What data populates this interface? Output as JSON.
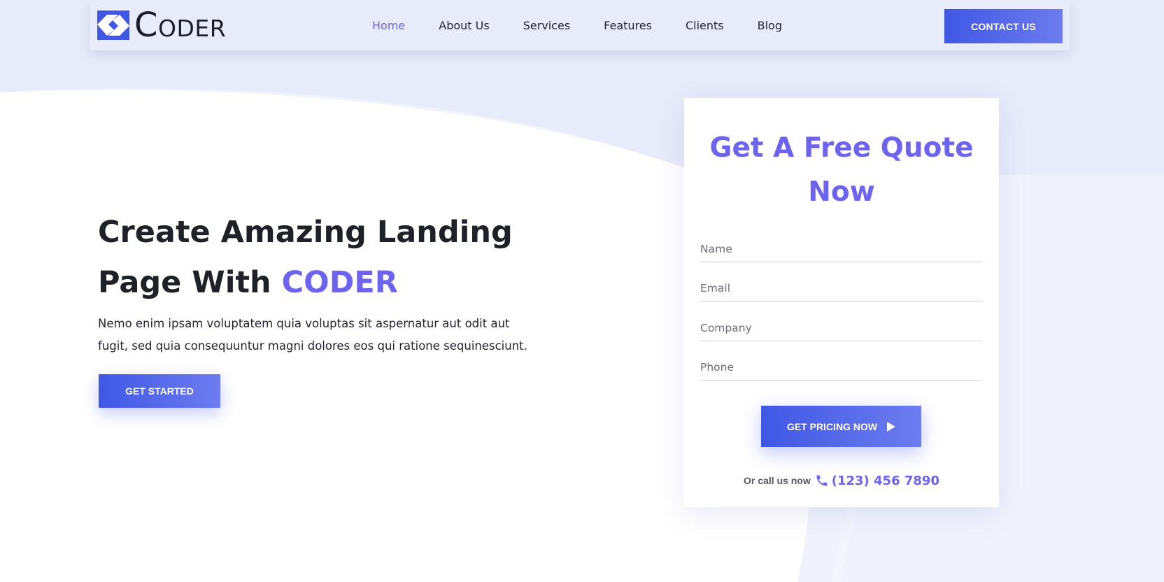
{
  "header": {
    "logo_text_initial": "C",
    "logo_text_rest": "ODER",
    "nav": [
      {
        "label": "Home",
        "active": true
      },
      {
        "label": "About Us",
        "active": false
      },
      {
        "label": "Services",
        "active": false
      },
      {
        "label": "Features",
        "active": false
      },
      {
        "label": "Clients",
        "active": false
      },
      {
        "label": "Blog",
        "active": false
      }
    ],
    "contact_label": "CONTACT US"
  },
  "hero": {
    "title_line1": "Create Amazing Landing",
    "title_line2": "Page With ",
    "title_accent": "CODER",
    "description_line1": "Nemo enim ipsam voluptatem quia voluptas sit aspernatur aut odit aut",
    "description_line2": "fugit, sed quia consequuntur magni dolores eos qui ratione sequinesciunt.",
    "cta_label": "GET STARTED"
  },
  "quote": {
    "title_line1": "Get A Free Quote",
    "title_line2": "Now",
    "fields": {
      "name": {
        "placeholder": "Name",
        "value": ""
      },
      "email": {
        "placeholder": "Email",
        "value": ""
      },
      "company": {
        "placeholder": "Company",
        "value": ""
      },
      "phone": {
        "placeholder": "Phone",
        "value": ""
      }
    },
    "submit_label": "GET PRICING NOW",
    "call_text": "Or call us now",
    "phone_number": "(123) 456 7890"
  },
  "icons": {
    "logo": "logo-icon",
    "play": "play-icon",
    "phone": "phone-icon"
  },
  "colors": {
    "accent": "#6c63f0",
    "button_start": "#3f57e4",
    "button_end": "#6d7cef",
    "background": "#e8ebf9",
    "card": "#ffffff"
  }
}
